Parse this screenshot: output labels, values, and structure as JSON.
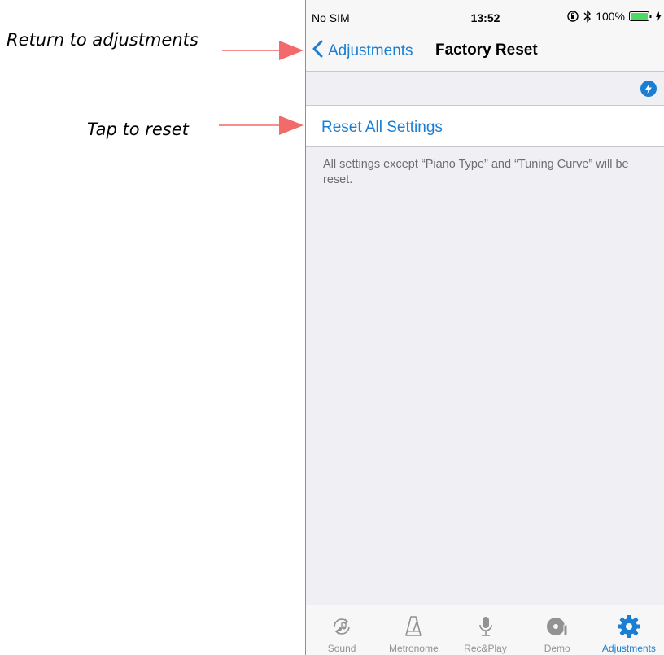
{
  "annotations": {
    "back": "Return to adjustments",
    "reset": "Tap to reset"
  },
  "colors": {
    "accent": "#1a7fd4",
    "annotation_arrow": "#f26a6a",
    "background": "#efeff4",
    "battery": "#4cd964"
  },
  "status_bar": {
    "carrier": "No SIM",
    "time": "13:52",
    "battery": "100%",
    "icons": [
      "orientation-lock-icon",
      "bluetooth-icon",
      "battery-icon",
      "charging-icon"
    ]
  },
  "nav": {
    "back_label": "Adjustments",
    "title": "Factory Reset"
  },
  "badge_icon": "flash-icon",
  "settings": {
    "reset_label": "Reset All Settings",
    "footer": "All settings except “Piano Type” and “Tuning Curve” will be reset."
  },
  "tabs": [
    {
      "label": "Sound",
      "icon": "sound-icon",
      "active": false
    },
    {
      "label": "Metronome",
      "icon": "metronome-icon",
      "active": false
    },
    {
      "label": "Rec&Play",
      "icon": "microphone-icon",
      "active": false
    },
    {
      "label": "Demo",
      "icon": "demo-disc-icon",
      "active": false
    },
    {
      "label": "Adjustments",
      "icon": "gear-icon",
      "active": true
    }
  ]
}
